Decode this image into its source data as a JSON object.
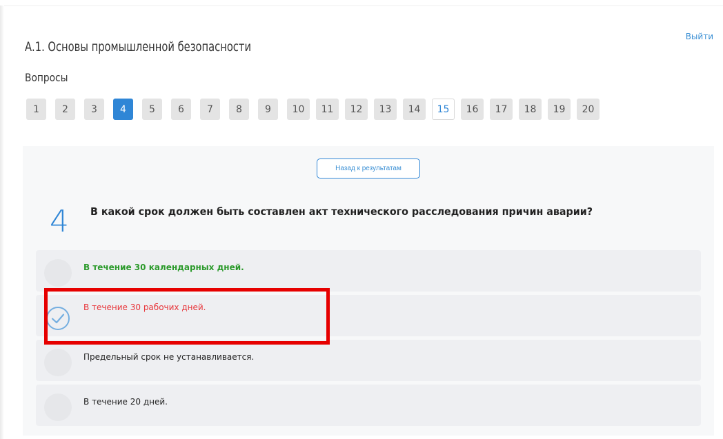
{
  "header": {
    "logout_label": "Выйти",
    "title": "А.1. Основы промышленной безопасности",
    "questions_label": "Вопросы"
  },
  "question_nav": {
    "buttons": [
      {
        "label": "1",
        "state": "answered"
      },
      {
        "label": "2",
        "state": "answered"
      },
      {
        "label": "3",
        "state": "answered"
      },
      {
        "label": "4",
        "state": "current"
      },
      {
        "label": "5",
        "state": "answered"
      },
      {
        "label": "6",
        "state": "answered"
      },
      {
        "label": "7",
        "state": "answered"
      },
      {
        "label": "8",
        "state": "answered"
      },
      {
        "label": "9",
        "state": "answered"
      },
      {
        "label": "10",
        "state": "answered"
      },
      {
        "label": "11",
        "state": "answered"
      },
      {
        "label": "12",
        "state": "answered"
      },
      {
        "label": "13",
        "state": "answered"
      },
      {
        "label": "14",
        "state": "answered"
      },
      {
        "label": "15",
        "state": "unanswered"
      },
      {
        "label": "16",
        "state": "answered"
      },
      {
        "label": "17",
        "state": "answered"
      },
      {
        "label": "18",
        "state": "answered"
      },
      {
        "label": "19",
        "state": "answered"
      },
      {
        "label": "20",
        "state": "answered"
      }
    ]
  },
  "question": {
    "back_label": "Назад к результатам",
    "number": "4",
    "text": "В какой срок должен быть составлен акт технического расследования причин аварии?",
    "answers": [
      {
        "text": "В течение 30 календарных дней.",
        "status": "correct",
        "selected": false
      },
      {
        "text": "В течение 30 рабочих дней.",
        "status": "wrong",
        "selected": true
      },
      {
        "text": "Предельный срок не устанавливается.",
        "status": "neutral",
        "selected": false
      },
      {
        "text": "В течение 20 дней.",
        "status": "neutral",
        "selected": false
      }
    ]
  },
  "colors": {
    "accent": "#2f86d6",
    "correct": "#2b9a2b",
    "wrong": "#e8353a",
    "highlight": "#e60000"
  },
  "icons": {
    "selected_answer": "check-circle-icon"
  }
}
